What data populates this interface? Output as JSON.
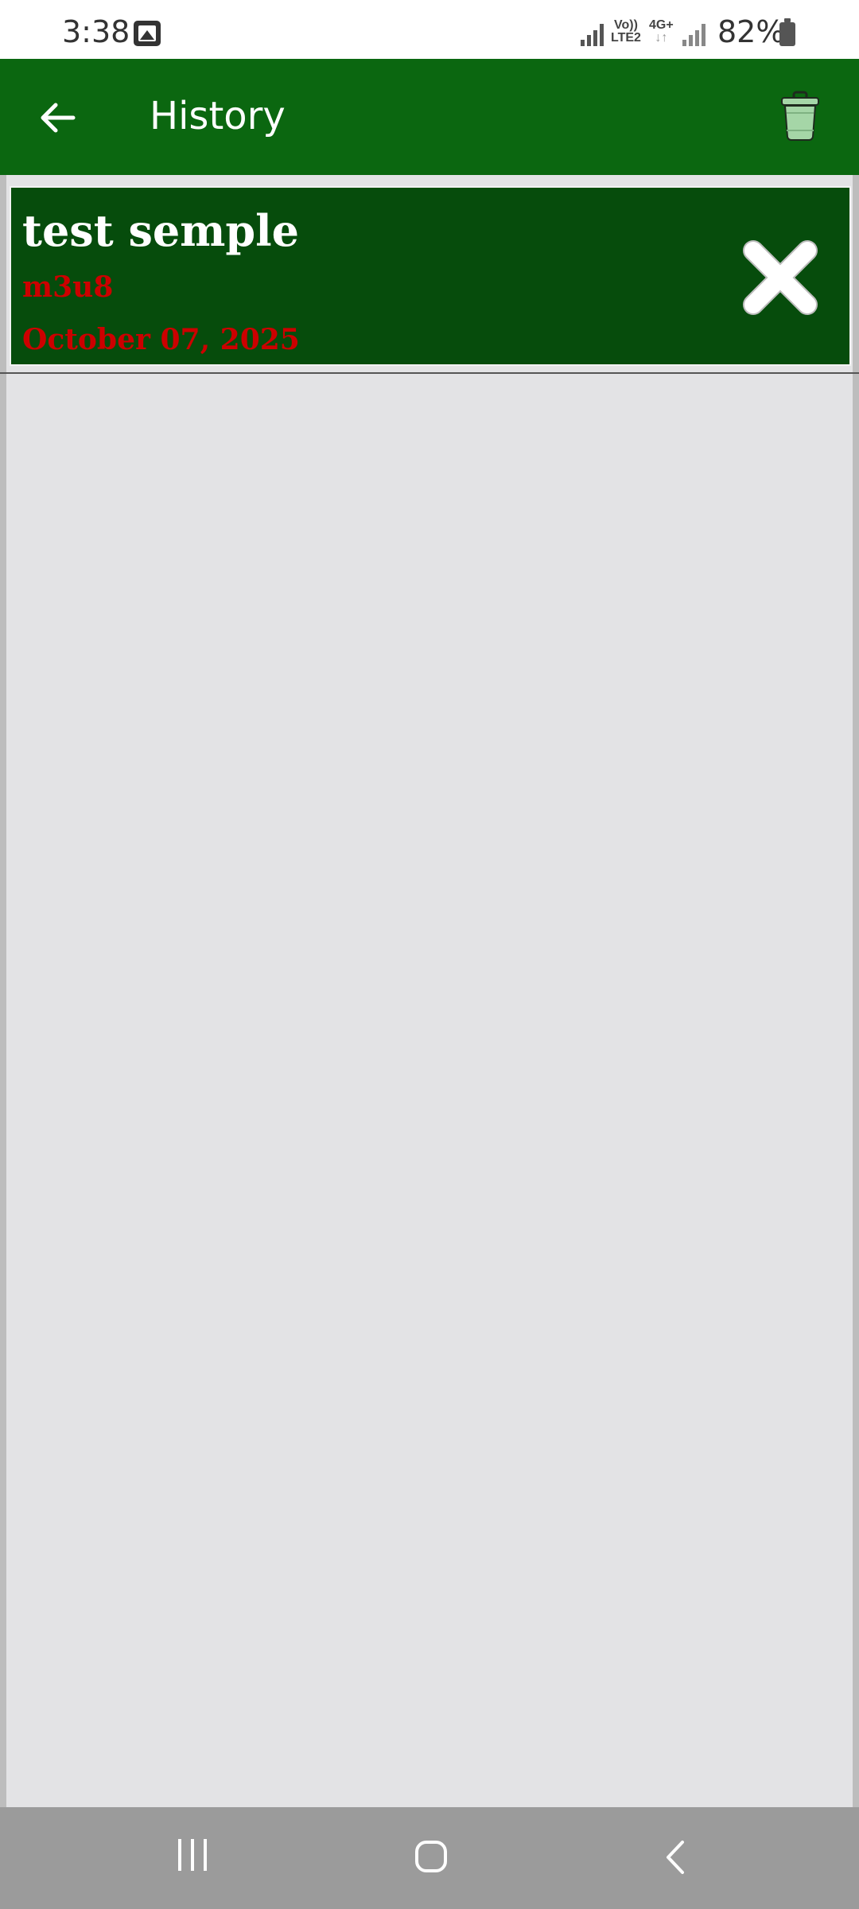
{
  "status_bar": {
    "time": "3:38",
    "network_top": "Vo))",
    "network_bottom": "LTE2",
    "network_type": "4G+",
    "battery_percent": "82%"
  },
  "app_bar": {
    "title": "History",
    "background_color": "#0b6710"
  },
  "history": {
    "items": [
      {
        "title": "test semple",
        "type": "m3u8",
        "date": "October 07, 2025"
      }
    ]
  },
  "colors": {
    "item_background": "#064c0c",
    "item_subtext": "#cc0000"
  }
}
